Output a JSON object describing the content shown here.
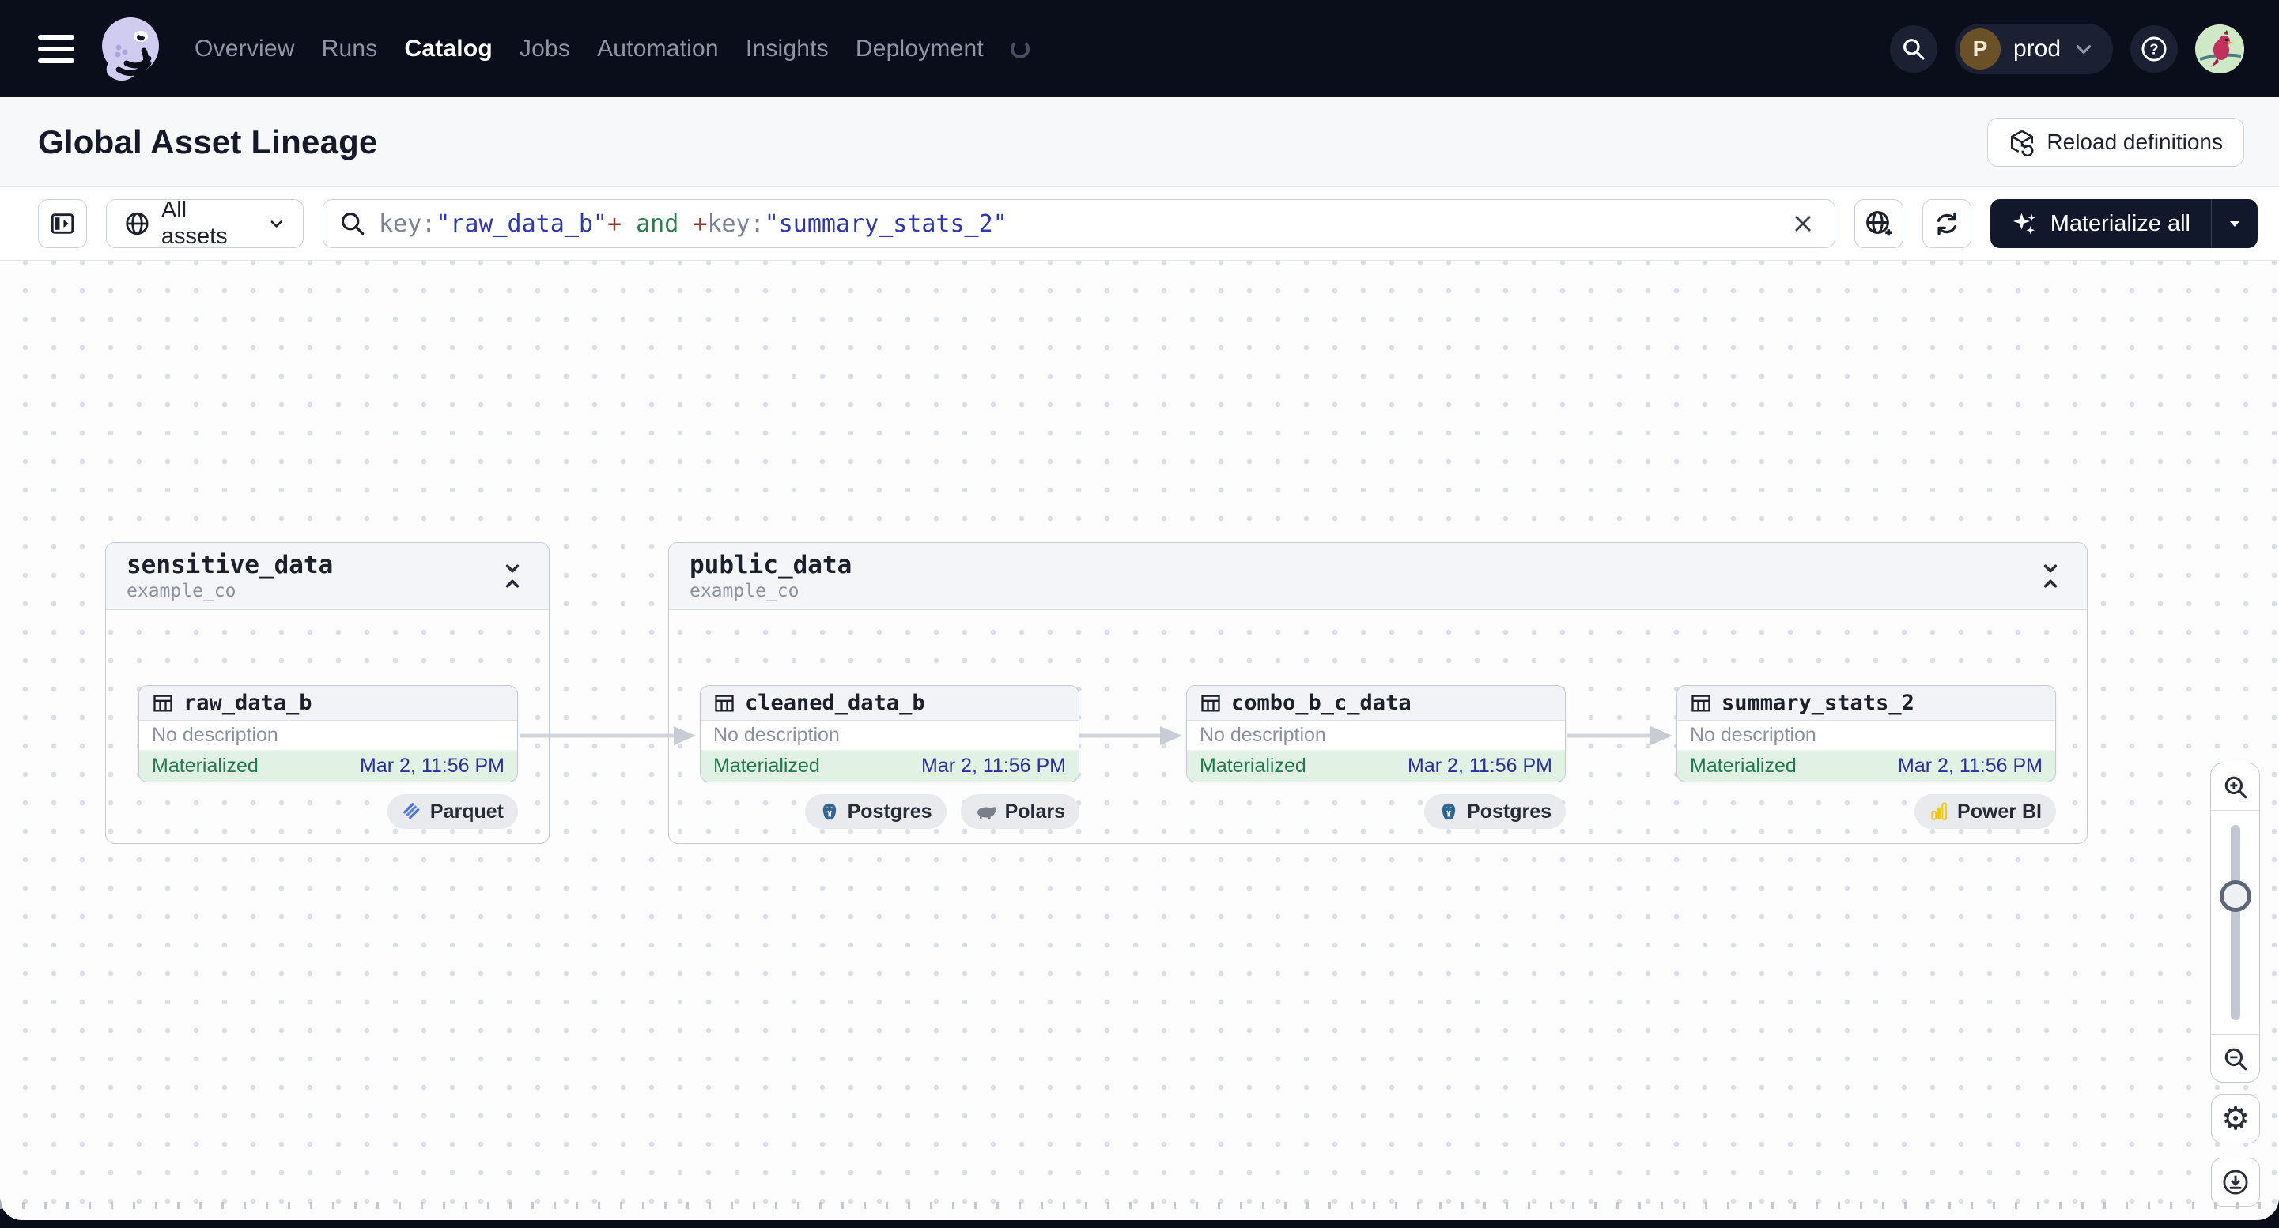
{
  "nav": {
    "menu_items": [
      "Overview",
      "Runs",
      "Catalog",
      "Jobs",
      "Automation",
      "Insights",
      "Deployment"
    ],
    "active_item": "Catalog",
    "deployment_name": "prod",
    "deployment_initial": "P"
  },
  "header": {
    "title": "Global Asset Lineage",
    "reload_button_label": "Reload definitions"
  },
  "toolbar": {
    "scope_label": "All assets",
    "materialize_label": "Materialize all",
    "search": {
      "t_key1": "key:",
      "t_val1": "\"raw_data_b\"",
      "t_plus1": "+",
      "t_and": " and ",
      "t_plus2": "+",
      "t_key2": "key:",
      "t_val2": "\"summary_stats_2\""
    }
  },
  "graph": {
    "groups": [
      {
        "name": "sensitive_data",
        "location": "example_co"
      },
      {
        "name": "public_data",
        "location": "example_co"
      }
    ],
    "nodes": [
      {
        "name": "raw_data_b",
        "description": "No description",
        "status": "Materialized",
        "timestamp": "Mar 2, 11:56 PM"
      },
      {
        "name": "cleaned_data_b",
        "description": "No description",
        "status": "Materialized",
        "timestamp": "Mar 2, 11:56 PM"
      },
      {
        "name": "combo_b_c_data",
        "description": "No description",
        "status": "Materialized",
        "timestamp": "Mar 2, 11:56 PM"
      },
      {
        "name": "summary_stats_2",
        "description": "No description",
        "status": "Materialized",
        "timestamp": "Mar 2, 11:56 PM"
      }
    ],
    "badges": {
      "raw": [
        "Parquet"
      ],
      "cleaned": [
        "Postgres",
        "Polars"
      ],
      "combo": [
        "Postgres"
      ],
      "summary": [
        "Power BI"
      ]
    }
  },
  "colors": {
    "nav_bg": "#0a0d1a",
    "canvas_bg": "#fdfdfe",
    "status_green_bg": "#e1f2e5",
    "status_green_text": "#217a4b",
    "timestamp_blue": "#2b2f9e",
    "syntax_key": "#7b8294",
    "syntax_string": "#3038ad",
    "syntax_plus": "#8a3b30",
    "syntax_and": "#2e7d4f",
    "powerbi_yellow": "#f2c811",
    "postgres_blue": "#336791",
    "parquet_blue": "#4a77d4"
  }
}
